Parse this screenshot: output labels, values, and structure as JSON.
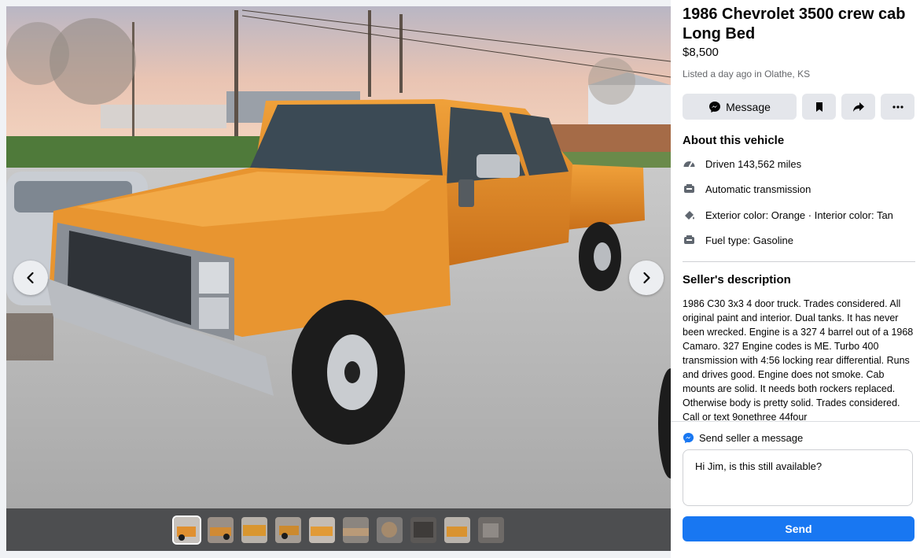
{
  "listing": {
    "title": "1986 Chevrolet 3500 crew cab Long Bed",
    "price": "$8,500",
    "listed": "Listed a day ago in Olathe, KS"
  },
  "actions": {
    "message_label": "Message",
    "icons": [
      "messenger-icon",
      "bookmark-icon",
      "share-icon",
      "more-icon"
    ]
  },
  "about": {
    "heading": "About this vehicle",
    "items": [
      {
        "icon": "speedometer-icon",
        "text": "Driven 143,562 miles"
      },
      {
        "icon": "transmission-icon",
        "text": "Automatic transmission"
      },
      {
        "icon": "paint-icon",
        "text": "Exterior color: Orange · Interior color: Tan"
      },
      {
        "icon": "fuel-icon",
        "text": "Fuel type: Gasoline"
      }
    ]
  },
  "seller": {
    "heading": "Seller's description",
    "description": "1986 C30 3x3 4 door truck. Trades considered. All original paint and interior. Dual tanks. It has never been wrecked. Engine is a 327 4 barrel out of a 1968 Camaro. 327 Engine codes is ME. Turbo 400 transmission with 4:56 locking rear differential. Runs and drives good. Engine does not smoke. Cab mounts are solid. It needs both rockers replaced. Otherwise body is pretty solid. Trades considered. Call or text 9onethree 44four"
  },
  "composer": {
    "label": "Send seller a message",
    "message": "Hi Jim, is this still available?",
    "send_label": "Send"
  },
  "gallery": {
    "thumbnail_count": 10,
    "active_index": 0
  },
  "colors": {
    "accent": "#1877f2",
    "truck": "#e8962a"
  }
}
